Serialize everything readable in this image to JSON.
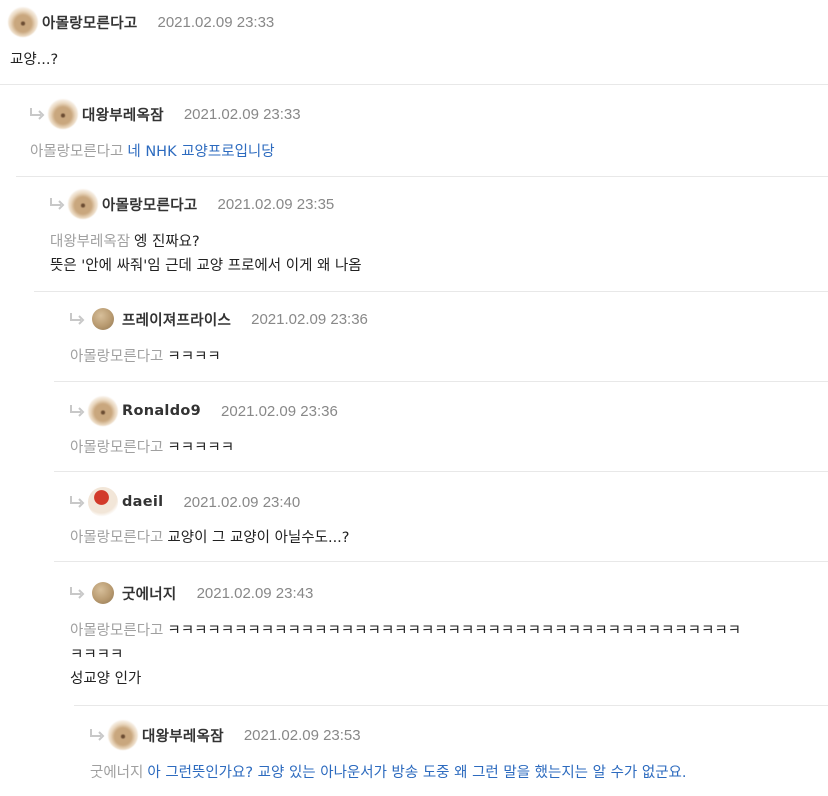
{
  "comments": [
    {
      "nick": "아몰랑모른다고",
      "date": "2021.02.09 23:33",
      "mention": "",
      "lines": [
        "교양...?"
      ]
    },
    {
      "nick": "대왕부레옥잠",
      "date": "2021.02.09 23:33",
      "mention": "아몰랑모른다고",
      "lines": [
        "네 NHK 교양프로입니당"
      ]
    },
    {
      "nick": "아몰랑모른다고",
      "date": "2021.02.09 23:35",
      "mention": "대왕부레옥잠",
      "lines": [
        "엥 진짜요?",
        "뜻은 '안에 싸줘'임 근데 교양 프로에서 이게 왜 나옴"
      ]
    },
    {
      "nick": "프레이져프라이스",
      "date": "2021.02.09 23:36",
      "mention": "아몰랑모른다고",
      "lines": [
        "ㅋㅋㅋㅋ"
      ]
    },
    {
      "nick": "Ronaldo9",
      "date": "2021.02.09 23:36",
      "mention": "아몰랑모른다고",
      "lines": [
        "ㅋㅋㅋㅋㅋ"
      ]
    },
    {
      "nick": "daeil",
      "date": "2021.02.09 23:40",
      "mention": "아몰랑모른다고",
      "lines": [
        "교양이 그 교양이 아닐수도...?"
      ]
    },
    {
      "nick": "굿에너지",
      "date": "2021.02.09 23:43",
      "mention": "아몰랑모른다고",
      "lines": [
        "ㅋㅋㅋㅋㅋㅋㅋㅋㅋㅋㅋㅋㅋㅋㅋㅋㅋㅋㅋㅋㅋㅋㅋㅋㅋㅋㅋㅋㅋㅋㅋㅋㅋㅋㅋㅋㅋㅋㅋㅋㅋㅋㅋ",
        "ㅋㅋㅋㅋ",
        "성교양 인가"
      ]
    },
    {
      "nick": "대왕부레옥잠",
      "date": "2021.02.09 23:53",
      "mention": "굿에너지",
      "lines": [
        "아 그런뜻인가요? 교양 있는 아나운서가 방송 도중 왜 그런 말을 했는지는 알 수가 없군요."
      ]
    }
  ]
}
